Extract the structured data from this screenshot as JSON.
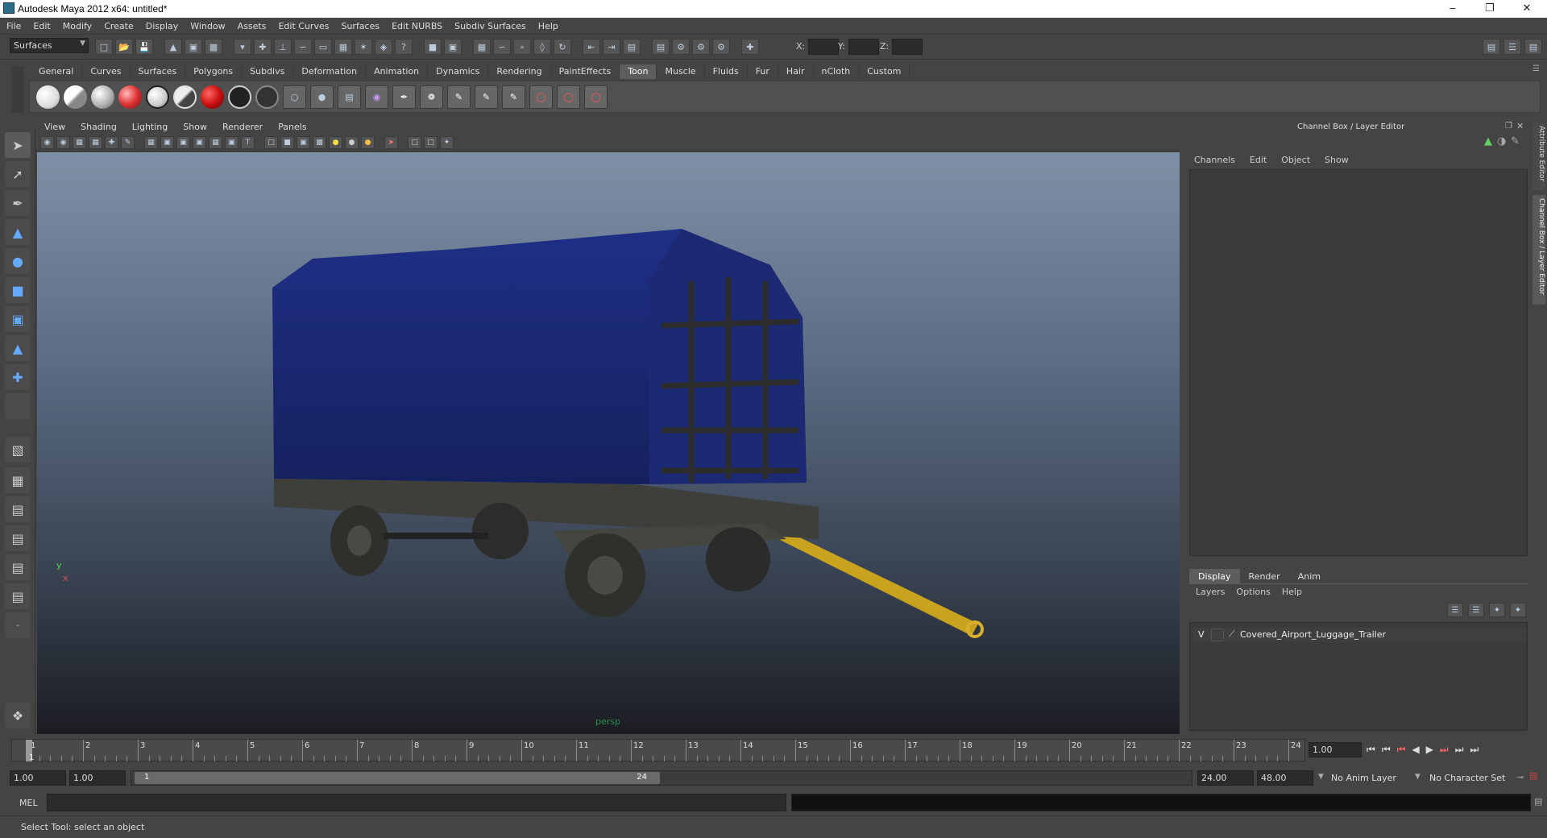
{
  "window": {
    "title": "Autodesk Maya 2012 x64: untitled*"
  },
  "menu": [
    "File",
    "Edit",
    "Modify",
    "Create",
    "Display",
    "Window",
    "Assets",
    "Edit Curves",
    "Surfaces",
    "Edit NURBS",
    "Subdiv Surfaces",
    "Help"
  ],
  "status_line": {
    "menuset": "Surfaces",
    "x_label": "X:",
    "y_label": "Y:",
    "z_label": "Z:"
  },
  "shelf": {
    "tabs": [
      "General",
      "Curves",
      "Surfaces",
      "Polygons",
      "Subdivs",
      "Deformation",
      "Animation",
      "Dynamics",
      "Rendering",
      "PaintEffects",
      "Toon",
      "Muscle",
      "Fluids",
      "Fur",
      "Hair",
      "nCloth",
      "Custom"
    ],
    "active_tab": "Toon"
  },
  "panel_menu": [
    "View",
    "Shading",
    "Lighting",
    "Show",
    "Renderer",
    "Panels"
  ],
  "viewport": {
    "camera": "persp",
    "axis_y": "y",
    "axis_x": "x",
    "object_colors": {
      "cover": "#1f2f86",
      "frame": "#3a3a36",
      "towbar": "#c9a21f"
    }
  },
  "channel_box": {
    "title": "Channel Box / Layer Editor",
    "menu": [
      "Channels",
      "Edit",
      "Object",
      "Show"
    ],
    "layer_tabs": [
      "Display",
      "Render",
      "Anim"
    ],
    "active_layer_tab": "Display",
    "layer_menu": [
      "Layers",
      "Options",
      "Help"
    ],
    "layer": {
      "visible": "V",
      "name": "Covered_Airport_Luggage_Trailer"
    }
  },
  "side_tabs": [
    "Attribute Editor",
    "Channel Box / Layer Editor"
  ],
  "timeline": {
    "ticks": [
      "1",
      "2",
      "3",
      "4",
      "5",
      "6",
      "7",
      "8",
      "9",
      "10",
      "11",
      "12",
      "13",
      "14",
      "15",
      "16",
      "17",
      "18",
      "19",
      "20",
      "21",
      "22",
      "23",
      "24"
    ],
    "current_marker": "1",
    "current_frame": "1.00"
  },
  "range": {
    "start": "1.00",
    "playback_start": "1.00",
    "slider_start": "1",
    "slider_end": "24",
    "playback_end": "24.00",
    "end": "48.00",
    "anim_layer": "No Anim Layer",
    "char_set": "No Character Set"
  },
  "command": {
    "label": "MEL"
  },
  "help_line": "Select Tool: select an object"
}
